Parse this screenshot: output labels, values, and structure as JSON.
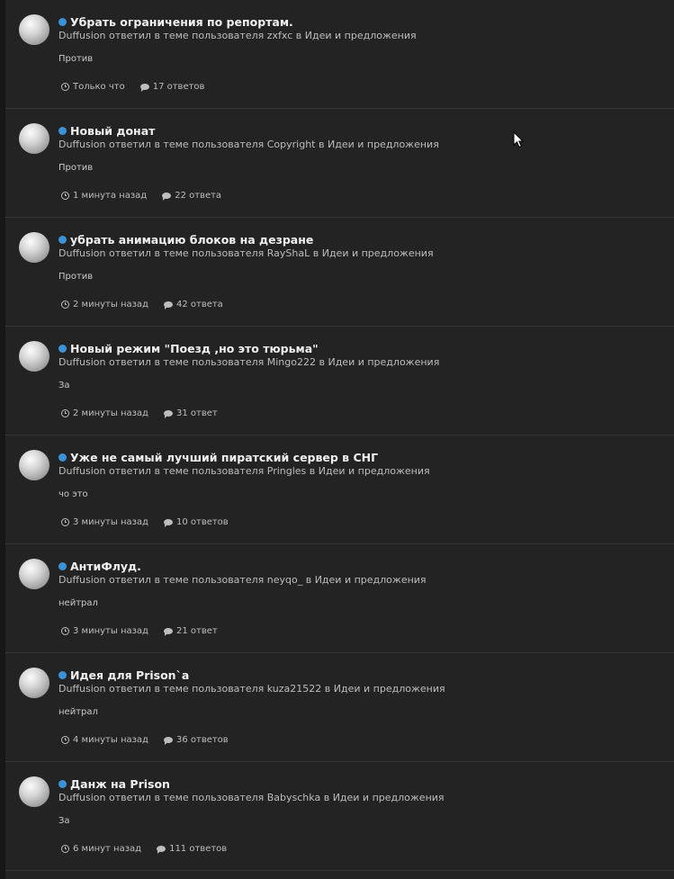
{
  "activity": {
    "items": [
      {
        "title": "Убрать ограничения по репортам.",
        "author": "Duffusion",
        "action_prefix": "ответил в теме пользователя",
        "topic_owner": "zxfxc",
        "in_word": "в",
        "forum": "Идеи и предложения",
        "snippet": "Против",
        "time": "Только что",
        "replies": "17 ответов"
      },
      {
        "title": "Новый донат",
        "author": "Duffusion",
        "action_prefix": "ответил в теме пользователя",
        "topic_owner": "Copyright",
        "in_word": "в",
        "forum": "Идеи и предложения",
        "snippet": "Против",
        "time": "1 минута назад",
        "replies": "22 ответа"
      },
      {
        "title": "убрать анимацию блоков на дезране",
        "author": "Duffusion",
        "action_prefix": "ответил в теме пользователя",
        "topic_owner": "RayShaL",
        "in_word": "в",
        "forum": "Идеи и предложения",
        "snippet": "Против",
        "time": "2 минуты назад",
        "replies": "42 ответа"
      },
      {
        "title": "Новый режим \"Поезд ,но это тюрьма\"",
        "author": "Duffusion",
        "action_prefix": "ответил в теме пользователя",
        "topic_owner": "Mingo222",
        "in_word": "в",
        "forum": "Идеи и предложения",
        "snippet": "За",
        "time": "2 минуты назад",
        "replies": "31 ответ"
      },
      {
        "title": "Уже не самый лучший пиратский сервер в СНГ",
        "author": "Duffusion",
        "action_prefix": "ответил в теме пользователя",
        "topic_owner": "Pringles",
        "in_word": "в",
        "forum": "Идеи и предложения",
        "snippet": "чо это",
        "time": "3 минуты назад",
        "replies": "10 ответов"
      },
      {
        "title": "АнтиФлуд.",
        "author": "Duffusion",
        "action_prefix": "ответил в теме пользователя",
        "topic_owner": "neyqo_",
        "in_word": "в",
        "forum": "Идеи и предложения",
        "snippet": "нейтрал",
        "time": "3 минуты назад",
        "replies": "21 ответ"
      },
      {
        "title": "Идея для Prison`a",
        "author": "Duffusion",
        "action_prefix": "ответил в теме пользователя",
        "topic_owner": "kuza21522",
        "in_word": "в",
        "forum": "Идеи и предложения",
        "snippet": "нейтрал",
        "time": "4 минуты назад",
        "replies": "36 ответов"
      },
      {
        "title": "Данж на Prison",
        "author": "Duffusion",
        "action_prefix": "ответил в теме пользователя",
        "topic_owner": "Babyschka",
        "in_word": "в",
        "forum": "Идеи и предложения",
        "snippet": "За",
        "time": "6 минут назад",
        "replies": "111 ответов"
      }
    ]
  },
  "colors": {
    "background": "#232323",
    "unread_dot": "#3b92d6",
    "title": "#f0f0f0",
    "meta": "#bdbdbd"
  },
  "icons": {
    "unread": "unread-dot-icon",
    "time": "clock-icon",
    "replies": "comment-icon",
    "pointer": "mouse-cursor-icon"
  }
}
